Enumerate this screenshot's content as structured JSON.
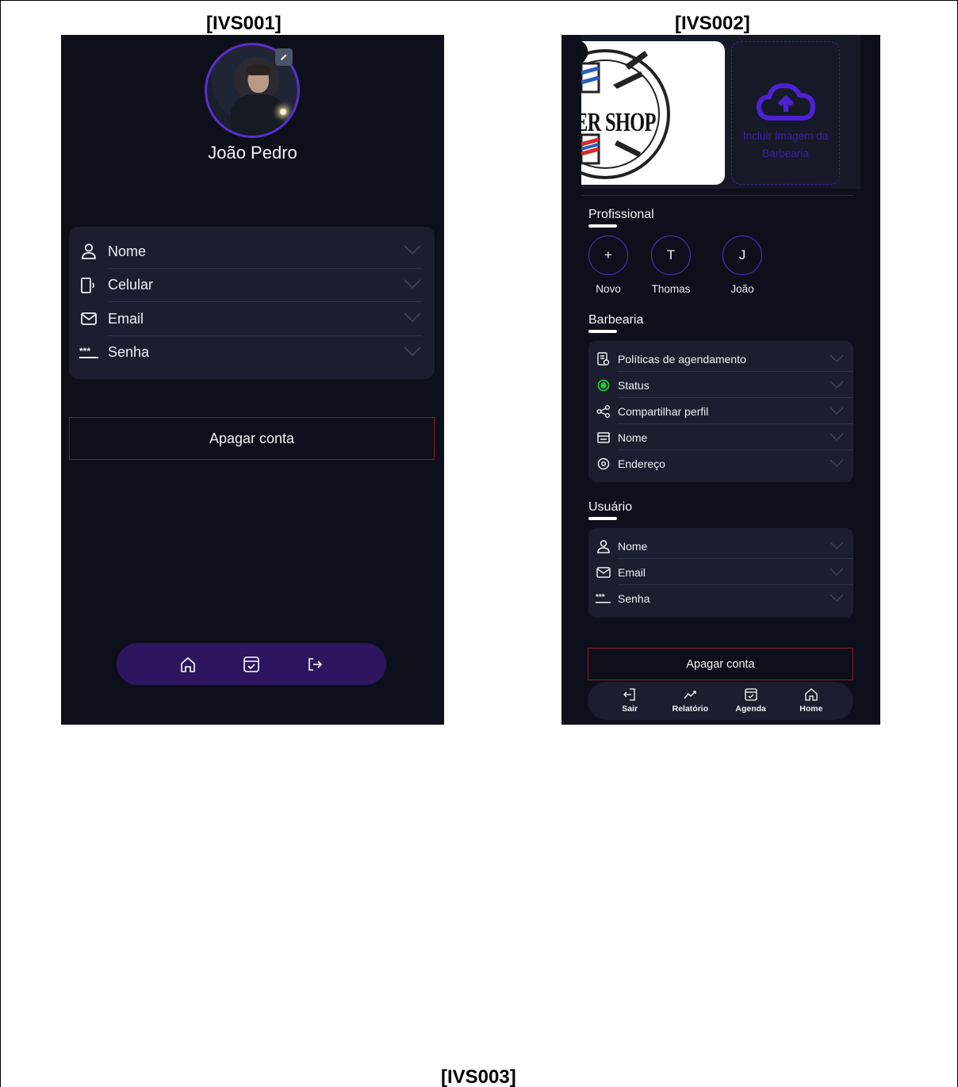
{
  "captions": {
    "screen1": "[IVS001]",
    "screen2": "[IVS002]",
    "screen3": "[IVS003]"
  },
  "screen1": {
    "user_name": "João Pedro",
    "fields": [
      {
        "label": "Nome",
        "icon": "user-icon"
      },
      {
        "label": "Celular",
        "icon": "phone-icon"
      },
      {
        "label": "Email",
        "icon": "mail-icon"
      },
      {
        "label": "Senha",
        "icon": "password-icon"
      }
    ],
    "delete_button": "Apagar conta",
    "nav": [
      "home-icon",
      "calendar-icon",
      "logout-icon"
    ]
  },
  "screen2": {
    "logo_text": "ER SHOP",
    "upload_label": "Incluir Imagem da Barbearia",
    "section_professional": "Profissional",
    "professionals": [
      {
        "initial": "+",
        "name": "Novo"
      },
      {
        "initial": "T",
        "name": "Thomas"
      },
      {
        "initial": "J",
        "name": "João"
      }
    ],
    "section_barbershop": "Barbearia",
    "barbershop_items": [
      {
        "label": "Políticas de agendamento",
        "icon": "policy-icon"
      },
      {
        "label": "Status",
        "icon": "status-icon"
      },
      {
        "label": "Compartilhar perfil",
        "icon": "share-icon"
      },
      {
        "label": "Nome",
        "icon": "store-icon"
      },
      {
        "label": "Endereço",
        "icon": "location-icon"
      }
    ],
    "section_user": "Usuário",
    "user_items": [
      {
        "label": "Nome",
        "icon": "user-icon"
      },
      {
        "label": "Email",
        "icon": "mail-icon"
      },
      {
        "label": "Senha",
        "icon": "password-icon"
      }
    ],
    "delete_button": "Apagar conta",
    "nav": [
      {
        "label": "Sair",
        "icon": "logout-icon"
      },
      {
        "label": "Relatório",
        "icon": "chart-icon"
      },
      {
        "label": "Agenda",
        "icon": "calendar-icon"
      },
      {
        "label": "Home",
        "icon": "home-icon"
      }
    ]
  },
  "colors": {
    "background": "#0d101a",
    "card": "#1a1e2e",
    "accent": "#5a2fd0",
    "danger": "#8a1a22",
    "status_on": "#22c832"
  }
}
